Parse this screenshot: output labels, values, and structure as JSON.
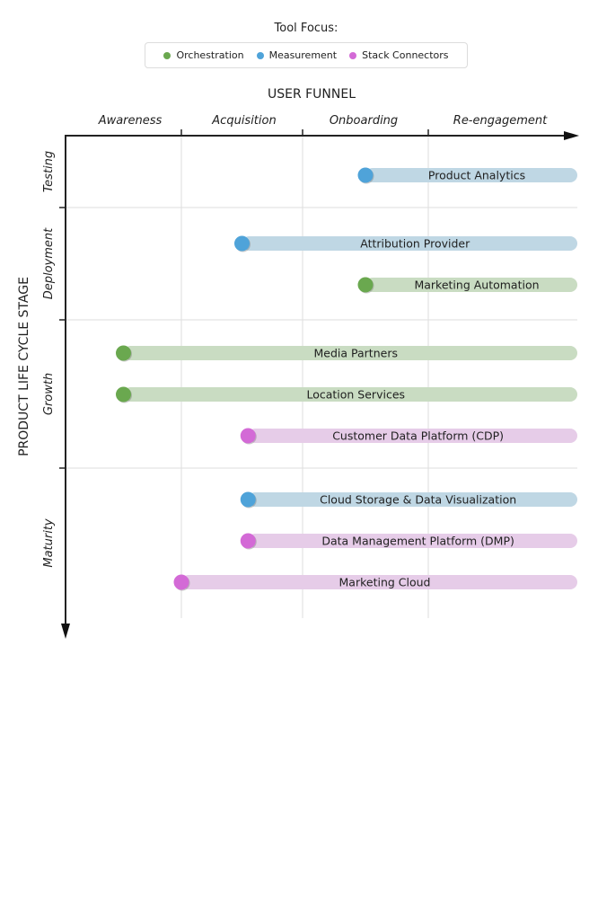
{
  "legend": {
    "title": "Tool Focus:",
    "items": [
      {
        "label": "Orchestration",
        "color": "#6aa84f"
      },
      {
        "label": "Measurement",
        "color": "#4fa3d9"
      },
      {
        "label": "Stack Connectors",
        "color": "#d36ad6"
      }
    ]
  },
  "chart_data": {
    "type": "bar",
    "subtype": "horizontal-range-timeline",
    "x_axis": {
      "title": "USER FUNNEL",
      "categories": [
        "Awareness",
        "Acquisition",
        "Onboarding",
        "Re-engagement"
      ]
    },
    "y_axis": {
      "title": "PRODUCT LIFE CYCLE STAGE",
      "categories": [
        "Testing",
        "Deployment",
        "Growth",
        "Maturity"
      ]
    },
    "series_colors": {
      "Orchestration": {
        "dot": "#6aa84f",
        "bar": "#c9dcc2"
      },
      "Measurement": {
        "dot": "#4fa3d9",
        "bar": "#bfd7e4"
      },
      "Stack Connectors": {
        "dot": "#d36ad6",
        "bar": "#e6cce8"
      }
    },
    "bars": [
      {
        "label": "Product Analytics",
        "stage": "Testing",
        "category": "Measurement",
        "start": 2.5,
        "end": 4.0
      },
      {
        "label": "Attribution Provider",
        "stage": "Deployment",
        "category": "Measurement",
        "start": 1.5,
        "end": 4.0
      },
      {
        "label": "Marketing Automation",
        "stage": "Deployment",
        "category": "Orchestration",
        "start": 2.5,
        "end": 4.0
      },
      {
        "label": "Media Partners",
        "stage": "Growth",
        "category": "Orchestration",
        "start": 0.5,
        "end": 4.0
      },
      {
        "label": "Location Services",
        "stage": "Growth",
        "category": "Orchestration",
        "start": 0.5,
        "end": 4.0
      },
      {
        "label": "Customer Data Platform (CDP)",
        "stage": "Growth",
        "category": "Stack Connectors",
        "start": 1.55,
        "end": 4.0
      },
      {
        "label": "Cloud Storage & Data Visualization",
        "stage": "Maturity",
        "category": "Measurement",
        "start": 1.55,
        "end": 4.0
      },
      {
        "label": "Data Management Platform (DMP)",
        "stage": "Maturity",
        "category": "Stack Connectors",
        "start": 1.55,
        "end": 4.0
      },
      {
        "label": "Marketing Cloud",
        "stage": "Maturity",
        "category": "Stack Connectors",
        "start": 1.0,
        "end": 4.0
      }
    ],
    "grid": true,
    "legend_position": "top-center"
  }
}
